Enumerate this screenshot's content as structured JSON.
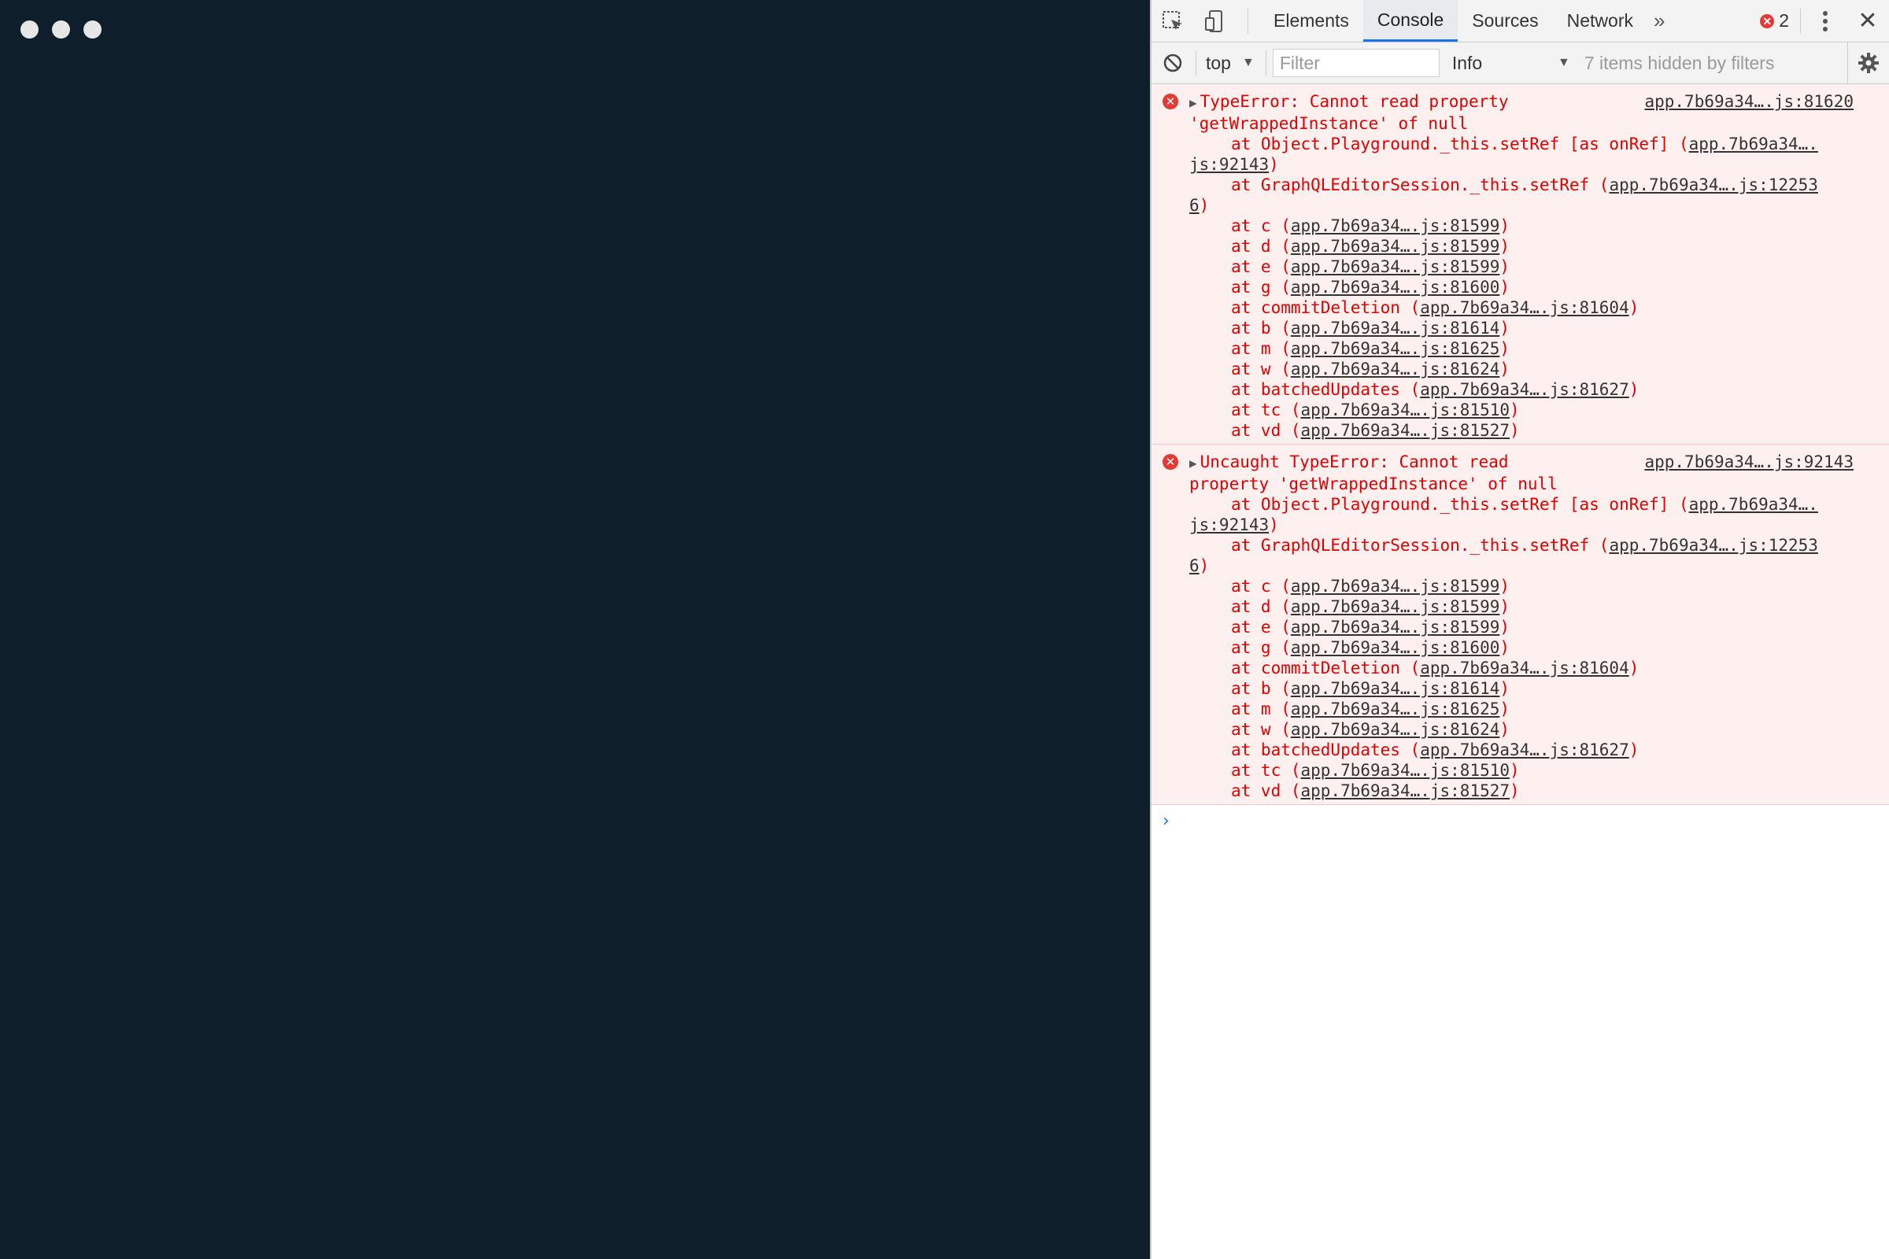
{
  "devtools": {
    "tabs": [
      "Elements",
      "Console",
      "Sources",
      "Network"
    ],
    "more_tabs_label": "»",
    "error_count": "2",
    "close_label": "✕"
  },
  "console_toolbar": {
    "context": "top",
    "filter_placeholder": "Filter",
    "level": "Info",
    "hidden_count": "7 items hidden by filters"
  },
  "messages": [
    {
      "title_1": "TypeError: Cannot read property",
      "title_2": "'getWrappedInstance' of null",
      "source": "app.7b69a34….js:81620",
      "frames": [
        {
          "fn": "at Object.Playground._this.setRef [as onRef] (",
          "file": "app.7b69a34….",
          "wrap": "js:92143",
          "end": ")"
        },
        {
          "fn": "at GraphQLEditorSession._this.setRef (",
          "file": "app.7b69a34….js:12253",
          "wrap": "6",
          "end": ")"
        },
        {
          "fn": "at c (",
          "file": "app.7b69a34….js:81599",
          "end": ")"
        },
        {
          "fn": "at d (",
          "file": "app.7b69a34….js:81599",
          "end": ")"
        },
        {
          "fn": "at e (",
          "file": "app.7b69a34….js:81599",
          "end": ")"
        },
        {
          "fn": "at g (",
          "file": "app.7b69a34….js:81600",
          "end": ")"
        },
        {
          "fn": "at commitDeletion (",
          "file": "app.7b69a34….js:81604",
          "end": ")"
        },
        {
          "fn": "at b (",
          "file": "app.7b69a34….js:81614",
          "end": ")"
        },
        {
          "fn": "at m (",
          "file": "app.7b69a34….js:81625",
          "end": ")"
        },
        {
          "fn": "at w (",
          "file": "app.7b69a34….js:81624",
          "end": ")"
        },
        {
          "fn": "at batchedUpdates (",
          "file": "app.7b69a34….js:81627",
          "end": ")"
        },
        {
          "fn": "at tc (",
          "file": "app.7b69a34….js:81510",
          "end": ")"
        },
        {
          "fn": "at vd (",
          "file": "app.7b69a34….js:81527",
          "end": ")"
        }
      ]
    },
    {
      "title_1": "Uncaught TypeError: Cannot read",
      "title_2": "property 'getWrappedInstance' of null",
      "source": "app.7b69a34….js:92143",
      "frames": [
        {
          "fn": "at Object.Playground._this.setRef [as onRef] (",
          "file": "app.7b69a34….",
          "wrap": "js:92143",
          "end": ")"
        },
        {
          "fn": "at GraphQLEditorSession._this.setRef (",
          "file": "app.7b69a34….js:12253",
          "wrap": "6",
          "end": ")"
        },
        {
          "fn": "at c (",
          "file": "app.7b69a34….js:81599",
          "end": ")"
        },
        {
          "fn": "at d (",
          "file": "app.7b69a34….js:81599",
          "end": ")"
        },
        {
          "fn": "at e (",
          "file": "app.7b69a34….js:81599",
          "end": ")"
        },
        {
          "fn": "at g (",
          "file": "app.7b69a34….js:81600",
          "end": ")"
        },
        {
          "fn": "at commitDeletion (",
          "file": "app.7b69a34….js:81604",
          "end": ")"
        },
        {
          "fn": "at b (",
          "file": "app.7b69a34….js:81614",
          "end": ")"
        },
        {
          "fn": "at m (",
          "file": "app.7b69a34….js:81625",
          "end": ")"
        },
        {
          "fn": "at w (",
          "file": "app.7b69a34….js:81624",
          "end": ")"
        },
        {
          "fn": "at batchedUpdates (",
          "file": "app.7b69a34….js:81627",
          "end": ")"
        },
        {
          "fn": "at tc (",
          "file": "app.7b69a34….js:81510",
          "end": ")"
        },
        {
          "fn": "at vd (",
          "file": "app.7b69a34….js:81527",
          "end": ")"
        }
      ]
    }
  ],
  "prompt_symbol": "›",
  "colors": {
    "app_background": "#0f1e2b",
    "error_text": "#e00000",
    "error_row_bg": "#fff0f0",
    "accent": "#1a73e8"
  }
}
